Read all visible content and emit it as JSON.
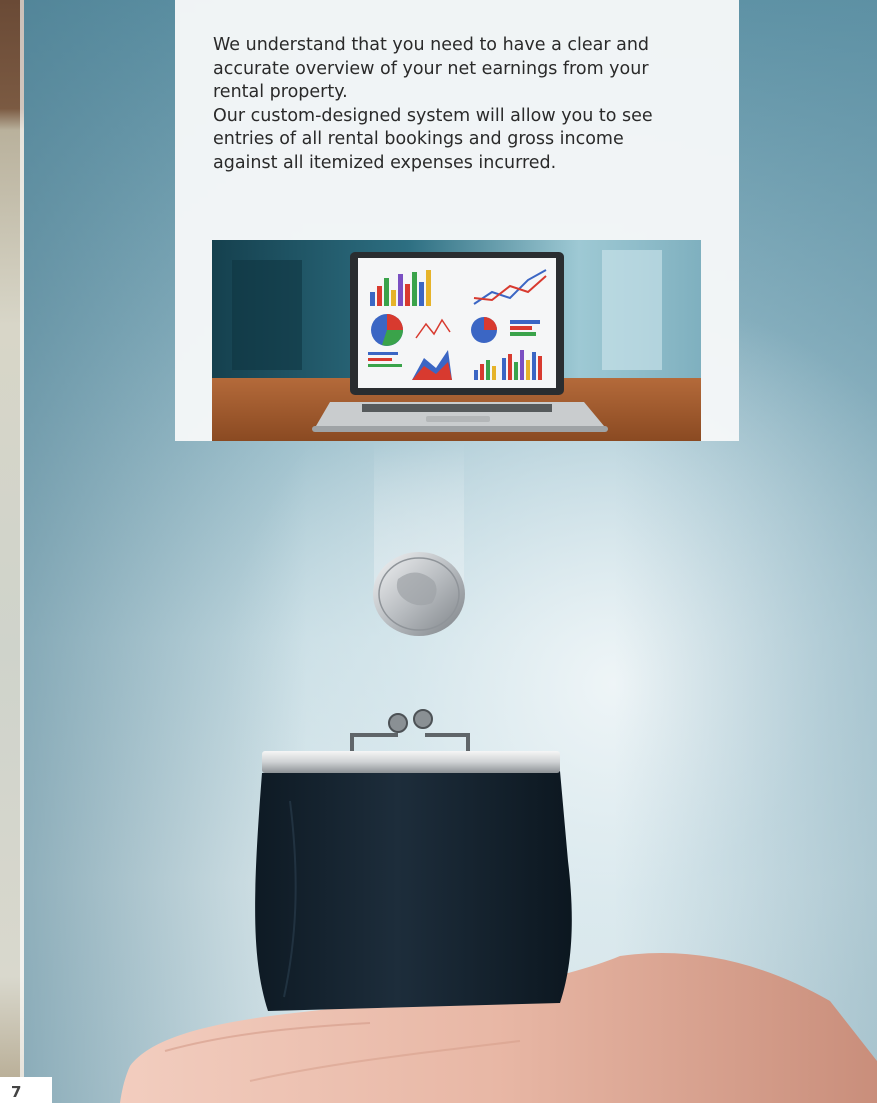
{
  "body": {
    "paragraph_1": "We understand that you need to have a clear and accurate overview of your net earnings from your rental property.",
    "paragraph_2": "Our custom-designed system will allow you to see entries of all rental bookings and gross income against all itemized expenses incurred."
  },
  "footer": {
    "page_number": "7"
  }
}
